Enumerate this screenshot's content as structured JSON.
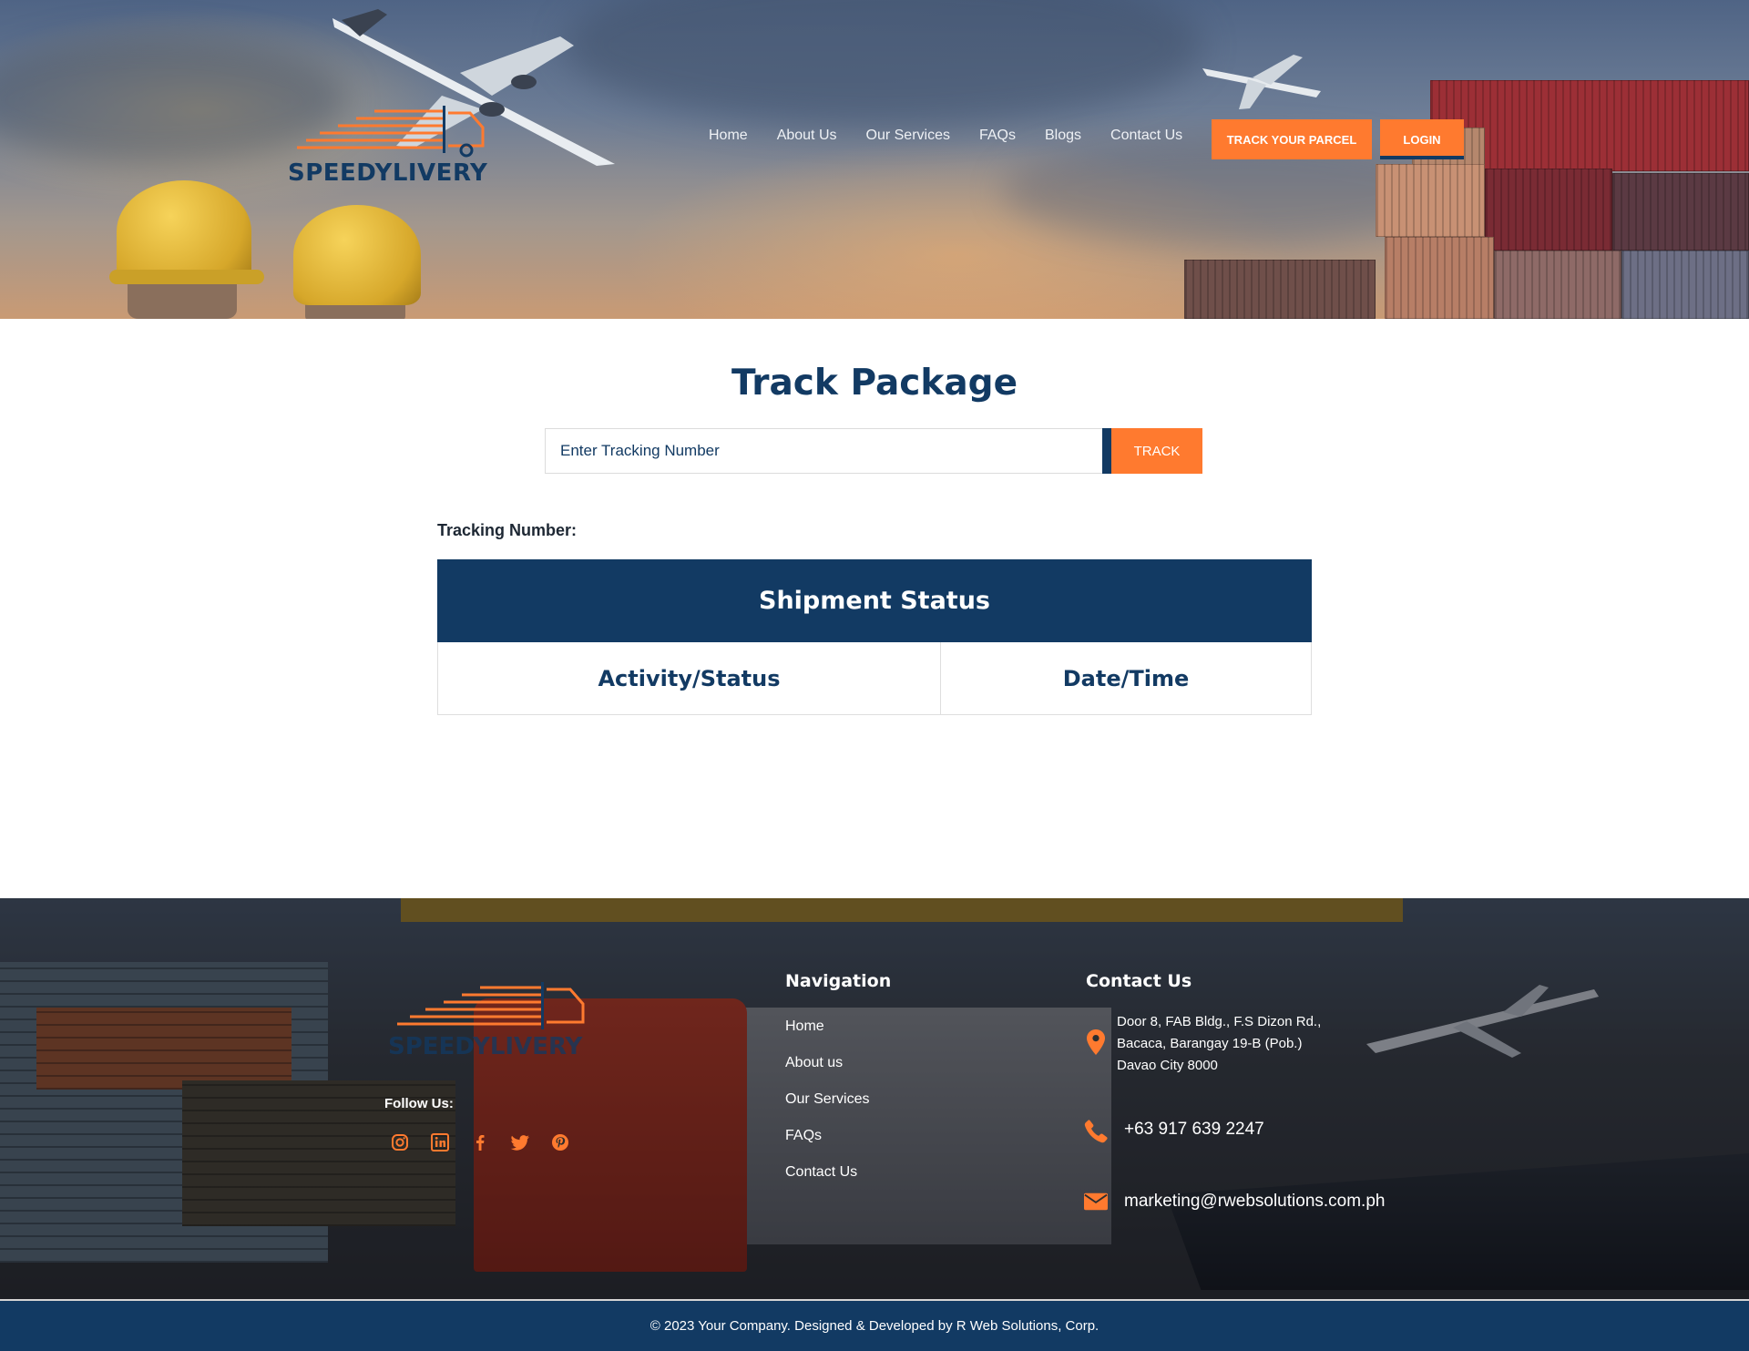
{
  "header": {
    "logo_text": "SPEEDYLIVERY",
    "nav": [
      "Home",
      "About Us",
      "Our Services",
      "FAQs",
      "Blogs",
      "Contact Us"
    ],
    "track_parcel_label": "TRACK YOUR PARCEL",
    "login_label": "LOGIN"
  },
  "main": {
    "title": "Track Package",
    "search": {
      "placeholder": "Enter Tracking Number",
      "value": "",
      "button_label": "TRACK"
    },
    "tracking_number_label": "Tracking Number:",
    "table": {
      "heading": "Shipment Status",
      "columns": [
        "Activity/Status",
        "Date/Time"
      ]
    }
  },
  "footer": {
    "logo_text": "SPEEDYLIVERY",
    "follow_label": "Follow Us:",
    "socials": [
      "instagram-icon",
      "linkedin-icon",
      "facebook-icon",
      "twitter-icon",
      "pinterest-icon"
    ],
    "navigation": {
      "heading": "Navigation",
      "links": [
        "Home",
        "About us",
        "Our Services",
        "FAQs",
        "Contact Us"
      ]
    },
    "contact": {
      "heading": "Contact Us",
      "address_lines": [
        "Door 8, FAB Bldg., F.S Dizon Rd.,",
        "Bacaca, Barangay 19-B (Pob.)",
        "Davao City 8000"
      ],
      "phone": "+63 917 639 2247",
      "email": "marketing@rwebsolutions.com.ph"
    },
    "copyright": "© 2023 Your Company. Designed & Developed by R Web Solutions, Corp."
  },
  "colors": {
    "primary_navy": "#123a63",
    "accent_orange": "#ff7a2f"
  }
}
